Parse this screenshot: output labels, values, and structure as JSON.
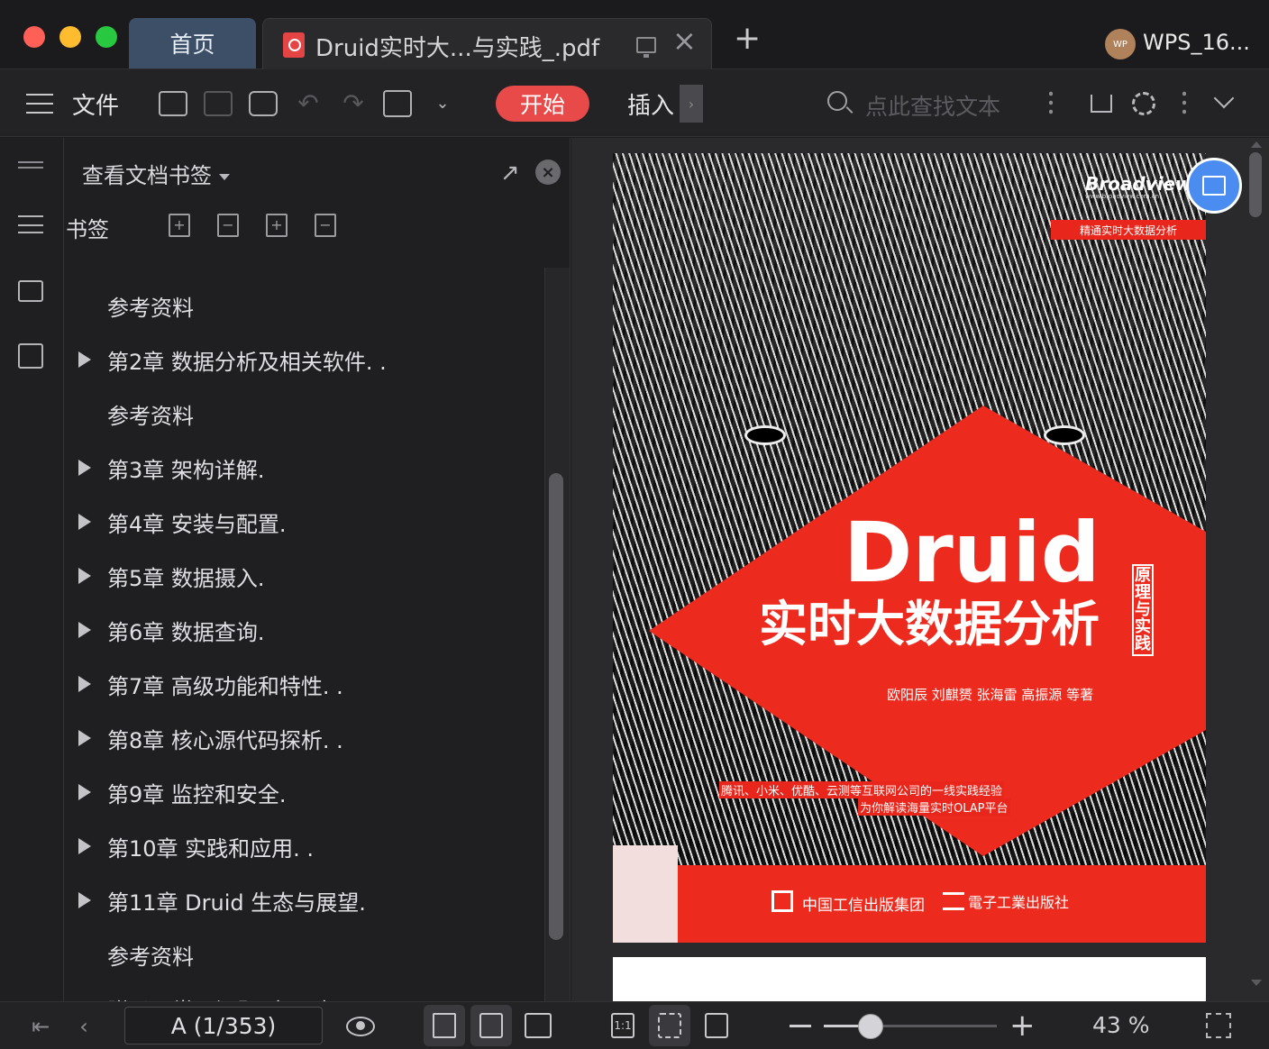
{
  "window": {
    "home_tab": "首页",
    "doc_tab_title": "Druid实时大...与实践_.pdf",
    "user_avatar_text": "WP",
    "user_name": "WPS_16..."
  },
  "toolbar": {
    "file_label": "文件",
    "start_label": "开始",
    "insert_label": "插入",
    "insert_more": "›",
    "search_placeholder": "点此查找文本"
  },
  "bookmark_panel": {
    "header": "查看文档书签",
    "section_label": "书签",
    "items": [
      {
        "text": "参考资料",
        "expandable": false
      },
      {
        "text": "第2章 数据分析及相关软件. .",
        "expandable": true
      },
      {
        "text": "参考资料",
        "expandable": false
      },
      {
        "text": "第3章 架构详解.",
        "expandable": true
      },
      {
        "text": "第4章 安装与配置.",
        "expandable": true
      },
      {
        "text": "第5章 数据摄入.",
        "expandable": true
      },
      {
        "text": "第6章 数据查询.",
        "expandable": true
      },
      {
        "text": "第7章 高级功能和特性. .",
        "expandable": true
      },
      {
        "text": "第8章 核心源代码探析. .",
        "expandable": true
      },
      {
        "text": "第9章 监控和安全.",
        "expandable": true
      },
      {
        "text": "第10章 实践和应用. .",
        "expandable": true
      },
      {
        "text": "第11章 Druid 生态与展望.",
        "expandable": true
      },
      {
        "text": "参考资料",
        "expandable": false
      },
      {
        "text": "附录A 常见问题（FAQ）",
        "expandable": false
      }
    ]
  },
  "cover": {
    "publisher_brand": "Broadview",
    "publisher_url": "www.broadview.com.cn",
    "top_tag": "精通实时大数据分析",
    "title": "Druid",
    "subtitle": "实时大数据分析",
    "vertical_subtitle": "原理与实践",
    "authors": "欧阳辰  刘麒赟  张海雷  高振源  等著",
    "tagline_1": "腾讯、小米、优酷、云测等互联网公司的一线实践经验",
    "tagline_2": "为你解读海量实时OLAP平台",
    "publisher_1": "中国工信出版集团",
    "publisher_2": "電子工業出版社"
  },
  "status": {
    "page_indicator": "A (1/353)",
    "zoom_percent": "43 %",
    "zoom_fraction": 0.27
  },
  "colors": {
    "accent_red": "#e84a4a",
    "home_tab_bg": "#3c4f66",
    "cover_red": "#ec2a1e",
    "float_button_blue": "#4b8cf0"
  }
}
